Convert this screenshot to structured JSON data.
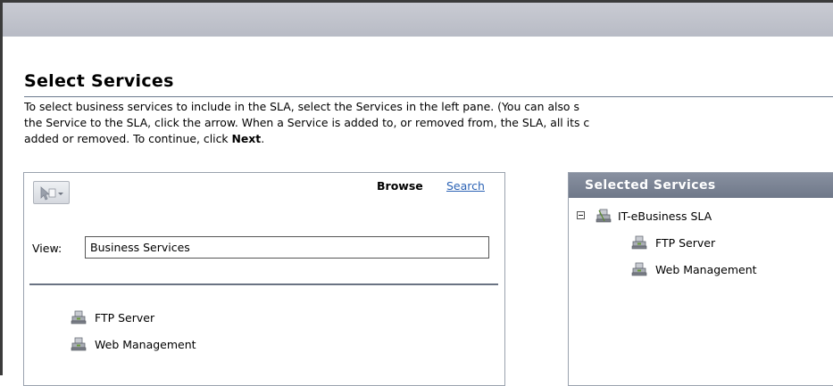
{
  "page": {
    "title": "Select Services",
    "description_1": "To select business services to include in the SLA, select the Services in the left pane. (You can also s",
    "description_2": "the Service to the SLA, click the arrow. When a Service is added to, or removed from, the SLA, all its c",
    "description_3a": "added or removed. To continue, click ",
    "description_3b": "Next",
    "description_3c": "."
  },
  "left_panel": {
    "browse_tab": "Browse",
    "search_tab": "Search",
    "view_label": "View:",
    "view_value": "Business Services",
    "items": [
      {
        "label": "FTP Server",
        "icon": "service-icon"
      },
      {
        "label": "Web Management",
        "icon": "service-icon"
      }
    ]
  },
  "right_panel": {
    "header": "Selected Services",
    "root": {
      "label": "IT-eBusiness SLA",
      "icon": "sla-icon",
      "expanded": true
    },
    "children": [
      {
        "label": "FTP Server",
        "icon": "service-icon"
      },
      {
        "label": "Web Management",
        "icon": "service-icon"
      }
    ]
  },
  "colors": {
    "header_bg": "#7b8394",
    "link": "#2c63b5",
    "topbar": "#c2c5cd"
  }
}
